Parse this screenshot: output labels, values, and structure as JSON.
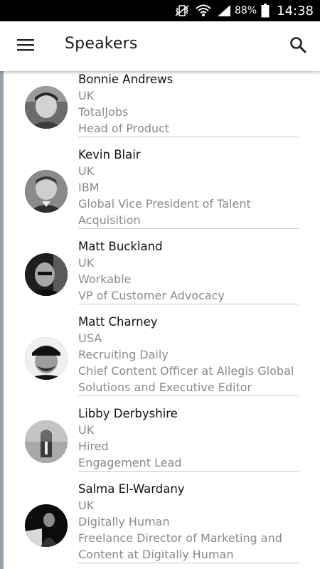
{
  "status_bar": {
    "battery_percent": "88%",
    "time": "14:38",
    "icons": [
      "mute-vibrate-icon",
      "wifi-icon",
      "signal-icon",
      "battery-icon"
    ]
  },
  "app_bar": {
    "title": "Speakers",
    "menu_icon": "hamburger-menu-icon",
    "search_icon": "search-icon"
  },
  "speakers": [
    {
      "name": "Bonnie Andrews",
      "country": "UK",
      "company": "TotalJobs",
      "title_lines": [
        "Head of Product"
      ]
    },
    {
      "name": "Kevin Blair",
      "country": "UK",
      "company": "IBM",
      "title_lines": [
        "Global Vice President of Talent",
        "Acquisition"
      ]
    },
    {
      "name": "Matt Buckland",
      "country": "UK",
      "company": "Workable",
      "title_lines": [
        "VP of Customer Advocacy"
      ]
    },
    {
      "name": "Matt Charney",
      "country": "USA",
      "company": "Recruiting Daily",
      "title_lines": [
        "Chief Content Officer at Allegis Global",
        "Solutions and Executive Editor"
      ]
    },
    {
      "name": "Libby Derbyshire",
      "country": "UK",
      "company": "Hired",
      "title_lines": [
        "Engagement Lead"
      ]
    },
    {
      "name": "Salma El-Wardany",
      "country": "UK",
      "company": "Digitally Human",
      "title_lines": [
        "Freelance Director of Marketing and",
        "Content at Digitally Human"
      ]
    }
  ],
  "colors": {
    "status_bar_bg": "#000000",
    "app_bar_bg": "#ffffff",
    "name_text": "#111111",
    "detail_text": "#8a8a8a",
    "divider": "#c8c8c8",
    "left_accent": "#9aa3aa"
  }
}
